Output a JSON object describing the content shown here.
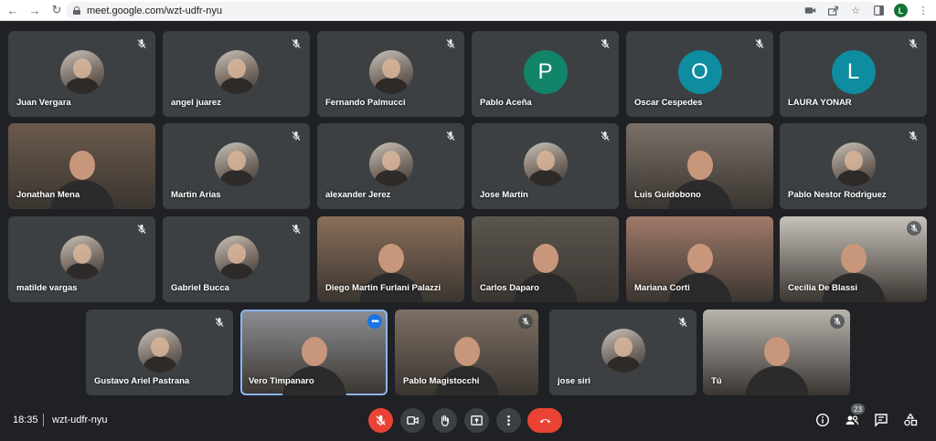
{
  "browser": {
    "url": "meet.google.com/wzt-udfr-nyu",
    "profile_initial": "L"
  },
  "participants": [
    {
      "name": "Juan Vergara",
      "type": "photo",
      "muted": true
    },
    {
      "name": "angel juarez",
      "type": "photo",
      "muted": true
    },
    {
      "name": "Fernando Palmucci",
      "type": "photo",
      "muted": true
    },
    {
      "name": "Pablo Aceña",
      "type": "initial",
      "initial": "P",
      "color": "#12846a",
      "muted": true
    },
    {
      "name": "Oscar Cespedes",
      "type": "initial",
      "initial": "O",
      "color": "#0e8ca0",
      "muted": true
    },
    {
      "name": "LAURA YONAR",
      "type": "initial",
      "initial": "L",
      "color": "#0e8ca0",
      "muted": true
    },
    {
      "name": "Jonathan Mena",
      "type": "video",
      "muted": false
    },
    {
      "name": "Martin Arias",
      "type": "photo",
      "muted": true
    },
    {
      "name": "alexander Jerez",
      "type": "photo",
      "muted": true
    },
    {
      "name": "Jose Martin",
      "type": "photo",
      "muted": true
    },
    {
      "name": "Luis Guidobono",
      "type": "video",
      "muted": false
    },
    {
      "name": "Pablo Nestor Rodriguez",
      "type": "photo",
      "muted": true
    },
    {
      "name": "matilde vargas",
      "type": "photo",
      "muted": true
    },
    {
      "name": "Gabriel Bucca",
      "type": "photo",
      "muted": true
    },
    {
      "name": "Diego Martin Furlani Palazzi",
      "type": "video",
      "muted": false
    },
    {
      "name": "Carlos Daparo",
      "type": "video",
      "muted": false
    },
    {
      "name": "Mariana Corti",
      "type": "video",
      "muted": false
    },
    {
      "name": "Cecilia De Blassi",
      "type": "video",
      "muted": true
    },
    {
      "name": "Gustavo Ariel Pastrana",
      "type": "photo",
      "muted": true
    },
    {
      "name": "Vero Timpanaro",
      "type": "video",
      "muted": false,
      "speaking": true
    },
    {
      "name": "Pablo Magistocchi",
      "type": "video",
      "muted": true
    },
    {
      "name": "jose siri",
      "type": "photo",
      "muted": true
    },
    {
      "name": "Tú",
      "type": "video",
      "muted": true
    }
  ],
  "meeting": {
    "time": "18:35",
    "code": "wzt-udfr-nyu",
    "participant_count": "23"
  },
  "colors": {
    "background": "#202124",
    "tile": "#3c4043",
    "end_call": "#ea4335",
    "active_border": "#8ab4f8"
  }
}
